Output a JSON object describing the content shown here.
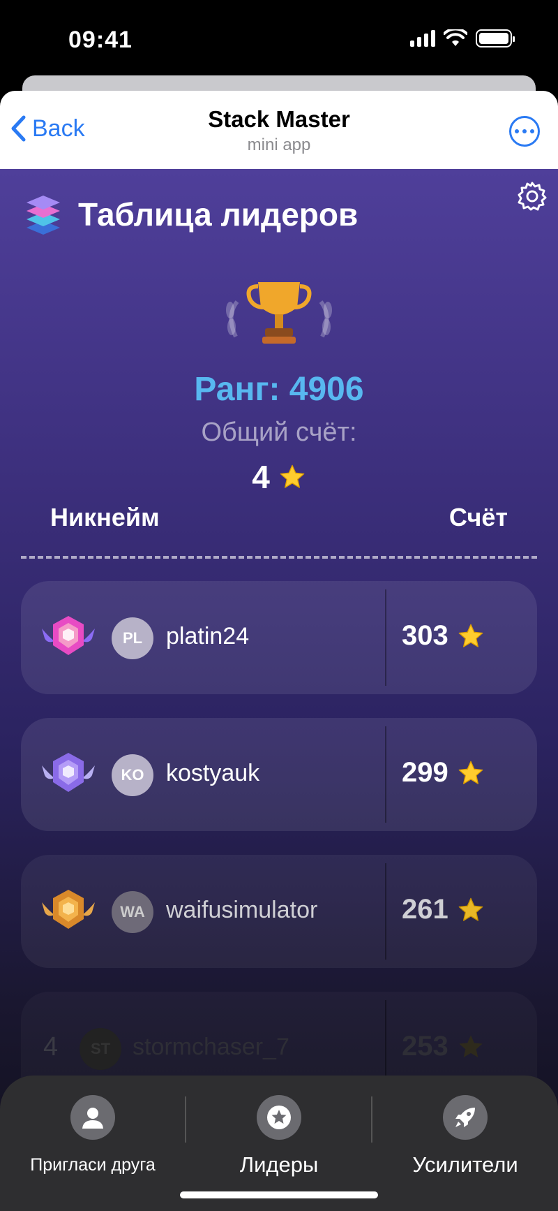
{
  "status": {
    "time": "09:41"
  },
  "header": {
    "back_label": "Back",
    "title": "Stack Master",
    "subtitle": "mini app"
  },
  "page": {
    "title": "Таблица лидеров"
  },
  "user": {
    "rank_text": "Ранг: 4906",
    "total_label": "Общий счёт:",
    "total_value": "4"
  },
  "columns": {
    "nickname": "Никнейм",
    "score": "Счёт"
  },
  "leaders": [
    {
      "initials": "PL",
      "nick": "platin24",
      "score": "303"
    },
    {
      "initials": "KO",
      "nick": "kostyauk",
      "score": "299"
    },
    {
      "initials": "WA",
      "nick": "waifusimulator",
      "score": "261"
    },
    {
      "place": "4",
      "initials": "ST",
      "nick": "stormchaser_7",
      "score": "253"
    }
  ],
  "nav": {
    "invite": "Пригласи друга",
    "leaders": "Лидеры",
    "boosters": "Усилители"
  },
  "colors": {
    "accent": "#2a7af3",
    "rank": "#58b8f0",
    "star": "#ffcc2e"
  }
}
